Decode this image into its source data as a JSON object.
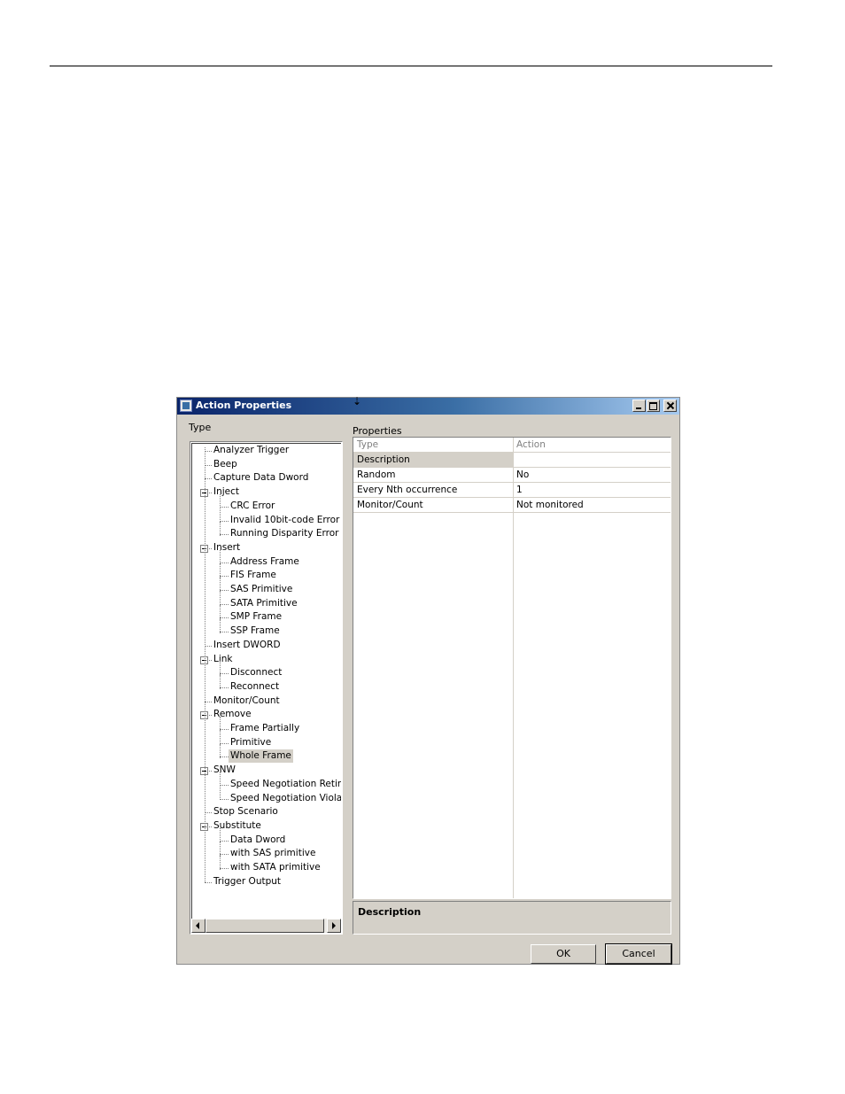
{
  "window": {
    "title": "Action Properties"
  },
  "type_label": "Type",
  "properties_label": "Properties",
  "tree": [
    {
      "label": "Analyzer Trigger",
      "level": 0
    },
    {
      "label": "Beep",
      "level": 0
    },
    {
      "label": "Capture Data Dword",
      "level": 0
    },
    {
      "label": "Inject",
      "level": 0,
      "expandable": true
    },
    {
      "label": "CRC Error",
      "level": 1
    },
    {
      "label": "Invalid 10bit-code Error",
      "level": 1
    },
    {
      "label": "Running Disparity Error",
      "level": 1
    },
    {
      "label": "Insert",
      "level": 0,
      "expandable": true
    },
    {
      "label": "Address Frame",
      "level": 1
    },
    {
      "label": "FIS Frame",
      "level": 1
    },
    {
      "label": "SAS Primitive",
      "level": 1
    },
    {
      "label": "SATA Primitive",
      "level": 1
    },
    {
      "label": "SMP Frame",
      "level": 1
    },
    {
      "label": "SSP Frame",
      "level": 1
    },
    {
      "label": "Insert DWORD",
      "level": 0
    },
    {
      "label": "Link",
      "level": 0,
      "expandable": true
    },
    {
      "label": "Disconnect",
      "level": 1
    },
    {
      "label": "Reconnect",
      "level": 1
    },
    {
      "label": "Monitor/Count",
      "level": 0
    },
    {
      "label": "Remove",
      "level": 0,
      "expandable": true
    },
    {
      "label": "Frame Partially",
      "level": 1
    },
    {
      "label": "Primitive",
      "level": 1
    },
    {
      "label": "Whole Frame",
      "level": 1,
      "selected": true
    },
    {
      "label": "SNW",
      "level": 0,
      "expandable": true
    },
    {
      "label": "Speed Negotiation Retime",
      "level": 1
    },
    {
      "label": "Speed Negotiation Violation",
      "level": 1
    },
    {
      "label": "Stop Scenario",
      "level": 0
    },
    {
      "label": "Substitute",
      "level": 0,
      "expandable": true
    },
    {
      "label": "Data Dword",
      "level": 1
    },
    {
      "label": "with SAS primitive",
      "level": 1
    },
    {
      "label": "with SATA primitive",
      "level": 1
    },
    {
      "label": "Trigger Output",
      "level": 0
    }
  ],
  "grid": {
    "header": {
      "key": "Type",
      "value": "Action"
    },
    "rows": [
      {
        "key": "Description",
        "value": "",
        "selected": true
      },
      {
        "key": "Random",
        "value": "No"
      },
      {
        "key": "Every Nth occurrence",
        "value": "1"
      },
      {
        "key": "Monitor/Count",
        "value": "Not monitored"
      }
    ]
  },
  "description_panel": {
    "title": "Description"
  },
  "buttons": {
    "ok": "OK",
    "cancel": "Cancel"
  }
}
